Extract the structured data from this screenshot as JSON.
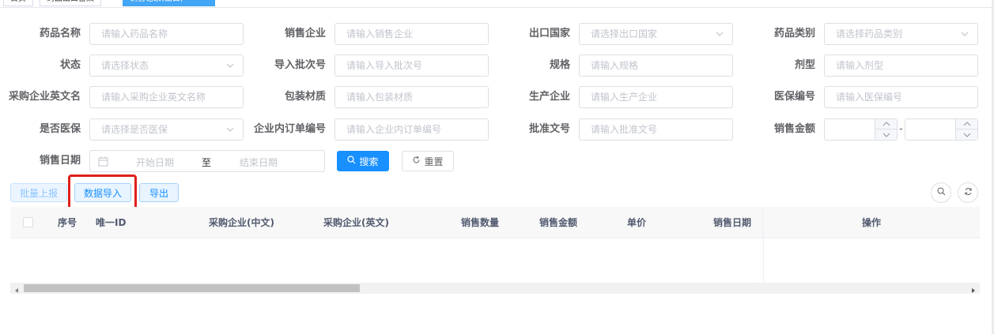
{
  "tabs": [
    {
      "label": "首页",
      "active": false
    },
    {
      "label": "药品出口备案",
      "active": false
    },
    {
      "label": "销售记录(出口)",
      "active": true
    }
  ],
  "filters": {
    "drug_name": {
      "label": "药品名称",
      "placeholder": "请输入药品名称"
    },
    "sales_company": {
      "label": "销售企业",
      "placeholder": "请输入销售企业"
    },
    "export_country": {
      "label": "出口国家",
      "placeholder": "请选择出口国家"
    },
    "drug_category": {
      "label": "药品类别",
      "placeholder": "请选择药品类别"
    },
    "status": {
      "label": "状态",
      "placeholder": "请选择状态"
    },
    "import_batch_no": {
      "label": "导入批次号",
      "placeholder": "请输入导入批次号"
    },
    "specification": {
      "label": "规格",
      "placeholder": "请输入规格"
    },
    "dosage_form": {
      "label": "剂型",
      "placeholder": "请输入剂型"
    },
    "purchaser_en_name": {
      "label": "采购企业英文名",
      "placeholder": "请输入采购企业英文名称"
    },
    "packaging_material": {
      "label": "包装材质",
      "placeholder": "请输入包装材质"
    },
    "manufacturer": {
      "label": "生产企业",
      "placeholder": "请输入生产企业"
    },
    "insurance_code": {
      "label": "医保编号",
      "placeholder": "请输入医保编号"
    },
    "is_insured": {
      "label": "是否医保",
      "placeholder": "请选择是否医保"
    },
    "internal_order_no": {
      "label": "企业内订单编号",
      "placeholder": "请输入企业内订单编号"
    },
    "approval_no": {
      "label": "批准文号",
      "placeholder": "请输入批准文号"
    },
    "sales_amount": {
      "label": "销售金额",
      "separator": "-"
    },
    "sales_date": {
      "label": "销售日期",
      "start_placeholder": "开始日期",
      "separator": "至",
      "end_placeholder": "结束日期"
    }
  },
  "actions": {
    "search": "搜索",
    "reset": "重置"
  },
  "toolbar": {
    "batch_report": "批量上报",
    "data_import": "数据导入",
    "export": "导出"
  },
  "table": {
    "columns": [
      "序号",
      "唯一ID",
      "采购企业(中文)",
      "采购企业(英文)",
      "销售数量",
      "销售金额",
      "单价",
      "销售日期",
      "操作"
    ],
    "rows": []
  },
  "colors": {
    "primary": "#1890ff",
    "highlight": "#e0201b"
  }
}
